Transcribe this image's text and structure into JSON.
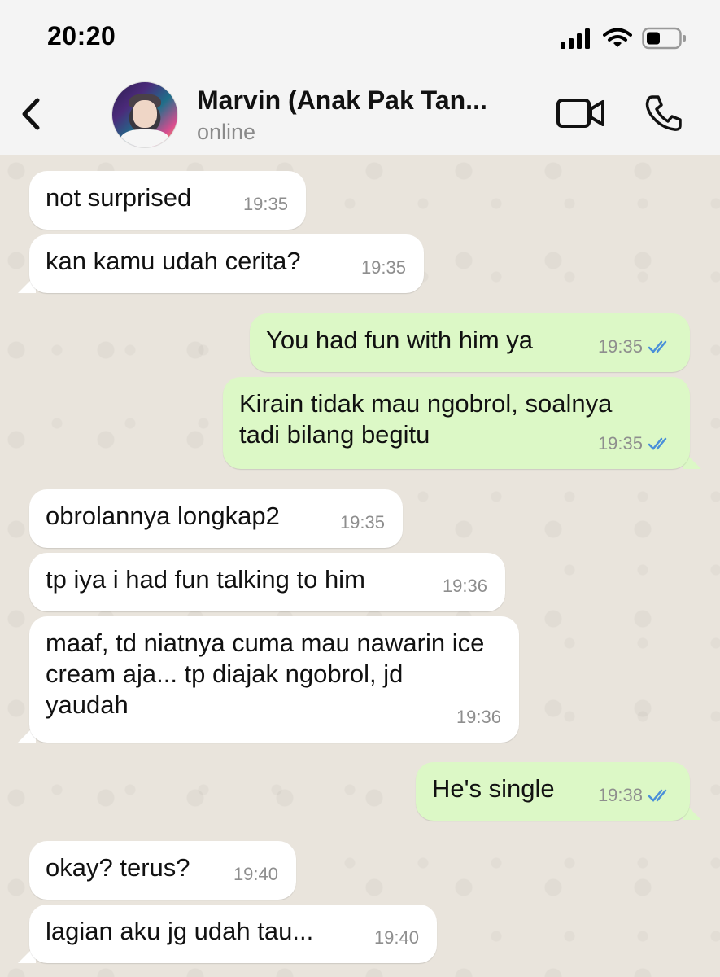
{
  "status_bar": {
    "time": "20:20"
  },
  "header": {
    "contact_name": "Marvin (Anak Pak Tan...",
    "status": "online"
  },
  "messages": [
    {
      "direction": "in",
      "text": "not surprised",
      "time": "19:35"
    },
    {
      "direction": "in",
      "text": "kan kamu udah cerita?",
      "time": "19:35"
    },
    {
      "direction": "out",
      "text": "You had fun with him ya",
      "time": "19:35",
      "read": true
    },
    {
      "direction": "out",
      "text": "Kirain tidak mau ngobrol, soalnya tadi bilang begitu",
      "time": "19:35",
      "read": true
    },
    {
      "direction": "in",
      "text": "obrolannya longkap2",
      "time": "19:35"
    },
    {
      "direction": "in",
      "text": "tp iya i had fun talking to him",
      "time": "19:36"
    },
    {
      "direction": "in",
      "text": "maaf, td niatnya cuma mau nawarin ice cream aja... tp diajak ngobrol, jd yaudah",
      "time": "19:36"
    },
    {
      "direction": "out",
      "text": "He's single",
      "time": "19:38",
      "read": true
    },
    {
      "direction": "in",
      "text": "okay? terus?",
      "time": "19:40"
    },
    {
      "direction": "in",
      "text": "lagian aku jg udah tau...",
      "time": "19:40"
    }
  ],
  "colors": {
    "incoming_bubble": "#ffffff",
    "outgoing_bubble": "#dcf8c6",
    "read_ticks": "#4a90d9",
    "chat_background": "#e9e4dc"
  },
  "icons": [
    "signal-icon",
    "wifi-icon",
    "battery-icon",
    "back-chevron-icon",
    "video-call-icon",
    "phone-icon",
    "read-ticks-icon"
  ]
}
